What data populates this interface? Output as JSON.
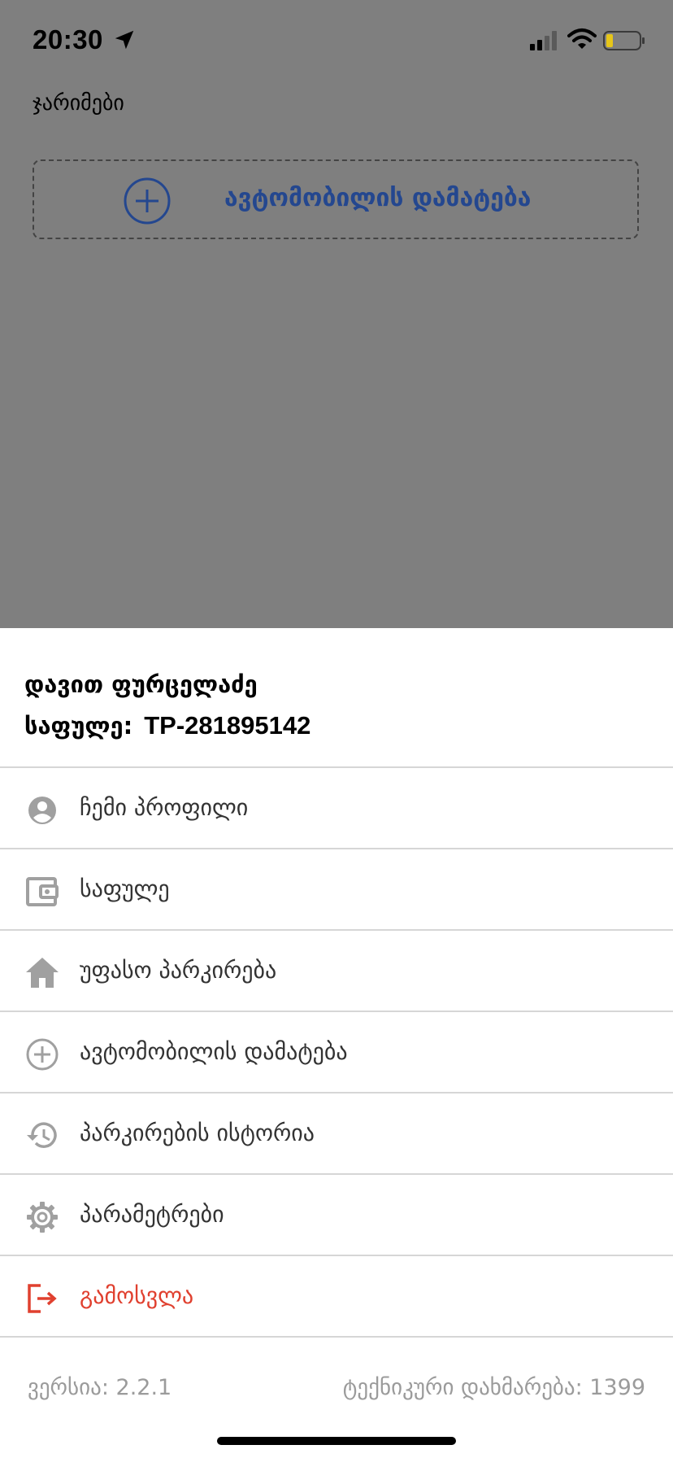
{
  "status_bar": {
    "time": "20:30"
  },
  "screen": {
    "title": "ჯარიმები",
    "add_car_card": {
      "label": "ავტომობილის დამატება"
    }
  },
  "drawer": {
    "user_name": "დავით ფურცელაძე",
    "wallet_label": "საფულე:",
    "wallet_id": "TP-281895142",
    "items": [
      {
        "label": "ჩემი პროფილი",
        "icon": "profile-icon"
      },
      {
        "label": "საფულე",
        "icon": "wallet-icon"
      },
      {
        "label": "უფასო პარკირება",
        "icon": "home-icon"
      },
      {
        "label": "ავტომობილის დამატება",
        "icon": "plus-circle-icon"
      },
      {
        "label": "პარკირების ისტორია",
        "icon": "history-icon"
      },
      {
        "label": "პარამეტრები",
        "icon": "gear-icon"
      },
      {
        "label": "გამოსვლა",
        "icon": "logout-icon"
      }
    ],
    "footer": {
      "version": "ვერსია: 2.2.1",
      "support": "ტექნიკური დახმარება: 1399"
    }
  },
  "colors": {
    "overlay": "#7f7f7f",
    "accent": "#24478f",
    "logout": "#e0402f",
    "icon_gray": "#a0a0a0",
    "divider": "#d6d6d6",
    "footer_text": "#9b9b9b"
  }
}
